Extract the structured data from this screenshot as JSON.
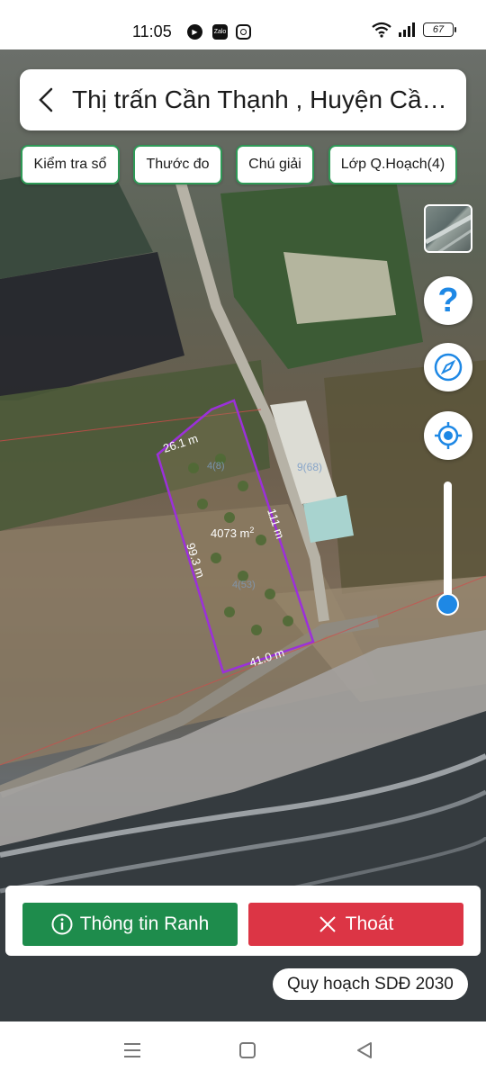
{
  "status_bar": {
    "time": "11:05",
    "app_icons": [
      "play-icon",
      "zalo-icon",
      "instagram-icon"
    ],
    "battery": "67"
  },
  "header": {
    "title": "Thị trấn Cần Thạnh , Huyện Cần ..."
  },
  "toolbar": {
    "chips": [
      "Kiểm tra sổ",
      "Thước đo",
      "Chú giải",
      "Lớp Q.Hoạch(4)"
    ]
  },
  "controls": {
    "help_label": "?",
    "zoom_level_fraction": 0.1
  },
  "parcel": {
    "area": "4073 m",
    "area_sup": "2",
    "edges": {
      "top": "26.1 m",
      "right": "111 m",
      "left": "99.3 m",
      "bottom": "41.0 m"
    },
    "map_labels": [
      "4(8)",
      "9(68)",
      "4(53)"
    ]
  },
  "actions": {
    "info_label": "Thông tin Ranh",
    "exit_label": "Thoát"
  },
  "plan_badge": "Quy hoạch SDĐ 2030",
  "colors": {
    "primary_green": "#1e8c4c",
    "danger_red": "#dc3545",
    "chip_border": "#2f9a57",
    "parcel_outline": "#9b30d9",
    "accent_blue": "#1e88e5"
  }
}
